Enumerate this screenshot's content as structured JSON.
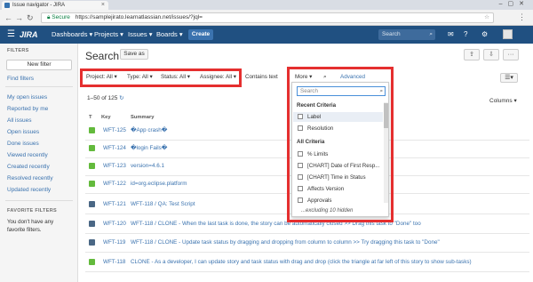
{
  "browser": {
    "tab_title": "Issue navigator - JIRA",
    "url_secure": "Secure",
    "url": "https://samplejirato.learnatlassian.net/issues/?jql="
  },
  "header": {
    "logo": "JIRA",
    "nav": [
      "Dashboards ▾",
      "Projects ▾",
      "Issues ▾",
      "Boards ▾"
    ],
    "create": "Create",
    "search_placeholder": "Search",
    "brand_color": "#205081"
  },
  "sidebar": {
    "filters_heading": "FILTERS",
    "new_filter": "New filter",
    "find_filters": "Find filters",
    "links": [
      "My open issues",
      "Reported by me",
      "All issues",
      "Open issues",
      "Done issues",
      "Viewed recently",
      "Created recently",
      "Resolved recently",
      "Updated recently"
    ],
    "favorite_heading": "FAVORITE FILTERS",
    "favorite_note": "You don't have any favorite filters."
  },
  "main": {
    "title": "Search",
    "save_as": "Save as",
    "criteria": [
      "Project: All ▾",
      "Type: All ▾",
      "Status: All ▾",
      "Assignee: All ▾"
    ],
    "contains_text": "Contains text",
    "more": "More ▾",
    "advanced": "Advanced",
    "pager_text": "1–50 of 125",
    "columns": "Columns ▾",
    "table_headers": [
      "T",
      "Key",
      "Summary"
    ],
    "rows": [
      {
        "key": "WFT-125",
        "summary": "�App crash�",
        "icon": "story-green"
      },
      {
        "key": "WFT-124",
        "summary": "�login Fails�",
        "icon": "story-green"
      },
      {
        "key": "WFT-123",
        "summary": "version=4.6.1",
        "icon": "story-green"
      },
      {
        "key": "WFT-122",
        "summary": "id=org.eclipse.platform",
        "icon": "story-green"
      },
      {
        "key": "WFT-121",
        "summary": "WFT-118 / QA: Test Script",
        "icon": "subtask-blue"
      },
      {
        "key": "WFT-120",
        "summary": "WFT-118 / CLONE - When the last task is done, the story can be automatically closed >> Drag this task to \"Done\" too",
        "icon": "subtask-blue"
      },
      {
        "key": "WFT-119",
        "summary": "WFT-118 / CLONE - Update task status by dragging and dropping from column to column >> Try dragging this task to \"Done\"",
        "icon": "subtask-blue"
      },
      {
        "key": "WFT-118",
        "summary": "CLONE - As a developer, I can update story and task status with drag and drop (click the triangle at far left of this story to show sub-tasks)",
        "icon": "story-green"
      }
    ]
  },
  "dropdown": {
    "search_placeholder": "Search",
    "recent_heading": "Recent Criteria",
    "recent": [
      "Label",
      "Resolution"
    ],
    "all_heading": "All Criteria",
    "all": [
      "% Limits",
      "[CHART] Date of First Resp...",
      "[CHART] Time in Status",
      "Affects Version",
      "Approvals"
    ],
    "footer": "...excluding 10 hidden"
  },
  "colors": {
    "highlight_box": "#e52f2f",
    "story": "#63ba3c",
    "subtask": "#4a6785"
  }
}
